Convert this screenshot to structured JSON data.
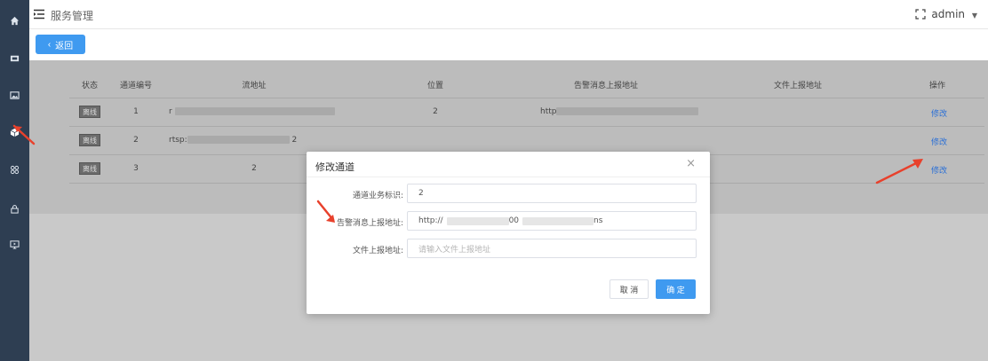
{
  "header": {
    "title": "服务管理",
    "user": "admin"
  },
  "toolbar": {
    "back_label": "返回"
  },
  "table": {
    "columns": [
      "状态",
      "通道编号",
      "流地址",
      "位置",
      "告警消息上报地址",
      "文件上报地址",
      "操作"
    ],
    "rows": [
      {
        "status": "离线",
        "id": "1",
        "stream": "r",
        "position": "2",
        "alarm": "http",
        "file": "",
        "action": "修改"
      },
      {
        "status": "离线",
        "id": "2",
        "stream": "rtsp:",
        "stream_tail": "2",
        "position": "",
        "alarm": "",
        "file": "",
        "action": "修改"
      },
      {
        "status": "离线",
        "id": "3",
        "stream": "2",
        "position": "",
        "alarm": "",
        "file": "",
        "action": "修改"
      }
    ]
  },
  "dialog": {
    "title": "修改通道",
    "close": "×",
    "fields": [
      {
        "label": "通道业务标识:",
        "value": "2",
        "placeholder": ""
      },
      {
        "label": "告警消息上报地址:",
        "value": "http://",
        "value_mid": "00",
        "value_end": "ns",
        "placeholder": ""
      },
      {
        "label": "文件上报地址:",
        "value": "",
        "placeholder": "请输入文件上报地址"
      }
    ],
    "cancel_label": "取 消",
    "ok_label": "确 定"
  },
  "colors": {
    "sidebar": "#2e3e52",
    "primary": "#3f9af0",
    "link": "#2a6fd6",
    "annotation": "#e8412c"
  },
  "icons": {
    "sidebar": [
      "home-icon",
      "image-icon",
      "picture-icon",
      "cube-icon",
      "apps-icon",
      "lock-icon",
      "monitor-icon"
    ],
    "header": [
      "hamburger-icon",
      "fullscreen-icon",
      "chevron-down-icon"
    ]
  }
}
